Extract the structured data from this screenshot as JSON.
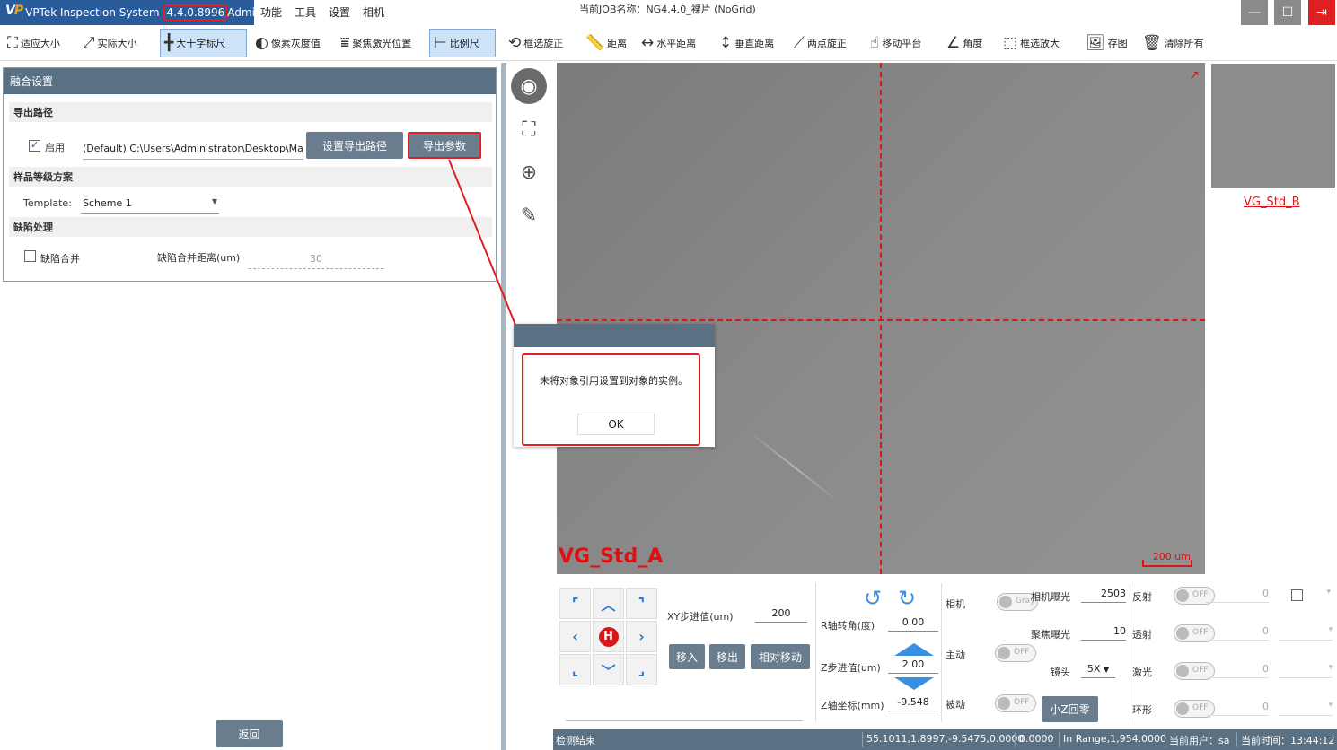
{
  "titlebar": {
    "app_name": "VPTek Inspection System",
    "version": "4.4.0.8996",
    "role": "Admin]",
    "menu": [
      "功能",
      "工具",
      "设置",
      "相机"
    ],
    "job": "当前JOB名称：NG4.4.0_裸片 (NoGrid)"
  },
  "toolbar": [
    {
      "label": "适应大小",
      "icon": "fit-icon"
    },
    {
      "label": "实际大小",
      "icon": "actual-size-icon"
    },
    {
      "label": "大十字标尺",
      "icon": "crosshair-icon"
    },
    {
      "label": "像素灰度值",
      "icon": "gray-value-icon"
    },
    {
      "label": "聚焦激光位置",
      "icon": "laser-focus-icon"
    },
    {
      "label": "比例尺",
      "icon": "scale-icon"
    },
    {
      "label": "框选旋正",
      "icon": "rotate-select-icon"
    },
    {
      "label": "距离",
      "icon": "ruler-icon"
    },
    {
      "label": "水平距离",
      "icon": "horizontal-distance-icon"
    },
    {
      "label": "垂直距离",
      "icon": "vertical-distance-icon"
    },
    {
      "label": "两点旋正",
      "icon": "two-point-rotate-icon"
    },
    {
      "label": "移动平台",
      "icon": "move-stage-icon"
    },
    {
      "label": "角度",
      "icon": "angle-icon"
    },
    {
      "label": "框选放大",
      "icon": "zoom-select-icon"
    },
    {
      "label": "存图",
      "icon": "save-image-icon"
    },
    {
      "label": "清除所有",
      "icon": "trash-icon"
    }
  ],
  "fusion": {
    "header": "融合设置",
    "export_section": "导出路径",
    "enable_label": "启用",
    "export_path": "(Default) C:\\Users\\Administrator\\Desktop\\Ma",
    "set_path_btn": "设置导出路径",
    "export_params_btn": "导出参数",
    "grading_section": "样品等级方案",
    "template_label": "Template:",
    "template_value": "Scheme 1",
    "defect_section": "缺陷处理",
    "merge_label": "缺陷合并",
    "merge_distance_label": "缺陷合并距离(um)",
    "merge_distance_value": "30",
    "back_btn": "返回"
  },
  "image": {
    "label": "VG_Std_A",
    "scale": "200 um",
    "thumb_label": "VG_Std_B"
  },
  "dialog": {
    "message": "未将对象引用设置到对象的实例。",
    "ok": "OK"
  },
  "control": {
    "xy_step_label": "XY步进值(um)",
    "xy_step_value": "200",
    "move_in": "移入",
    "move_out": "移出",
    "relative_move": "相对移动",
    "r_angle_label": "R轴转角(度)",
    "r_angle_value": "0.00",
    "z_step_label": "Z步进值(um)",
    "z_step_value": "2.00",
    "z_coord_label": "Z轴坐标(mm)",
    "z_coord_value": "-9.548",
    "camera_label": "相机",
    "camera_toggle": "Gray",
    "master_label": "主动",
    "master_toggle": "OFF",
    "slave_label": "被动",
    "slave_toggle": "OFF",
    "z_home_btn": "小Z回零",
    "exposure_label": "相机曝光",
    "exposure_value": "2503",
    "focus_exposure_label": "聚焦曝光",
    "focus_exposure_value": "10",
    "lens_label": "镜头",
    "lens_value": "5X",
    "reflect_label": "反射",
    "transmit_label": "透射",
    "laser_label": "激光",
    "ring_label": "环形",
    "lamp_toggle": "OFF",
    "lamp_value": "0"
  },
  "status": {
    "state": "检测结束",
    "coords": "55.1011,1.8997,-9.5475,0.0000",
    "value": "0.0000",
    "range": "In Range,1,954.0000",
    "user": "当前用户：sa",
    "time": "当前时间：13:44:12"
  },
  "colors": {
    "title_blue": "#2a5b9a",
    "panel_header": "#5a7183",
    "accent_red": "#e02020",
    "arrow_blue": "#3a90e0"
  }
}
